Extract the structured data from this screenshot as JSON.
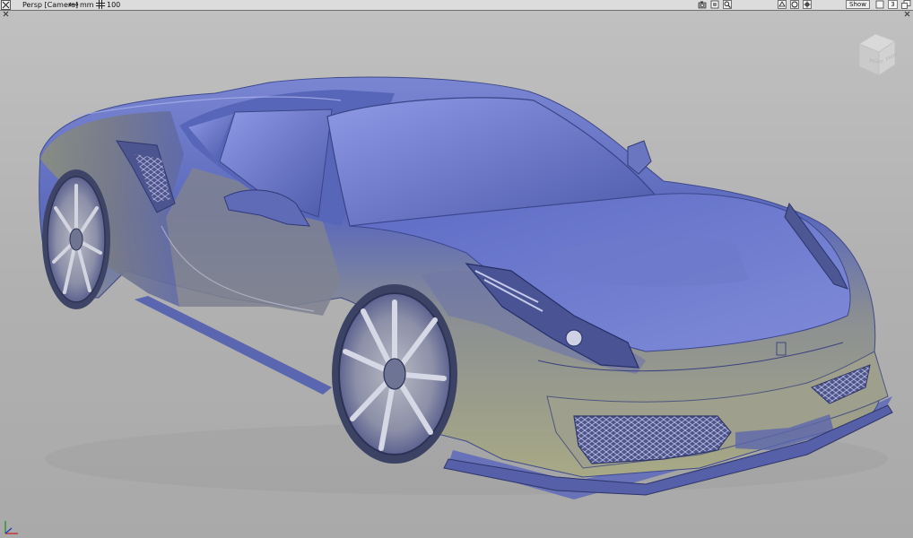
{
  "toolbar": {
    "view_label": "Persp [Camera]",
    "units_label": "mm",
    "grid_value": "100",
    "show_label": "Show",
    "view_count": "3"
  },
  "viewcube": {
    "faces": [
      "RIGHT",
      "FRONT"
    ]
  },
  "icons": [
    "close-icon",
    "units-arrows-icon",
    "grid-icon",
    "camera-icon",
    "screen-icon",
    "zoom-icon",
    "display-mode-icon",
    "shade-icon",
    "center-icon",
    "box-icon",
    "maximize-icon"
  ],
  "colors": {
    "toolbar_bg": "#dcdcdc",
    "viewport_bg": "#b4b4b4",
    "car_body_blue": "#5f6fbf",
    "car_body_silver": "#9a9c82"
  }
}
